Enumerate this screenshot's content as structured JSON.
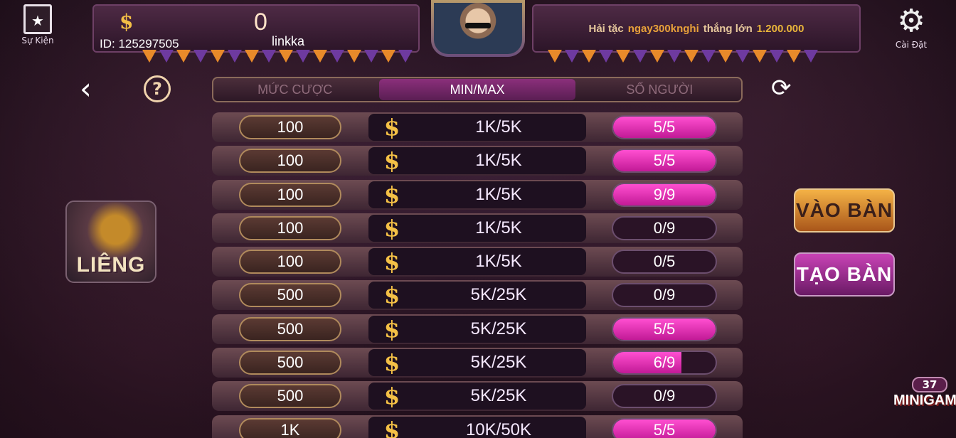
{
  "top": {
    "event_label": "Sự Kiện",
    "settings_label": "Cài Đặt",
    "balance": "0",
    "player_id": "ID: 125297505",
    "player_name": "linkka",
    "announcement": {
      "prefix": "Hải tặc",
      "user": "ngay300knghi",
      "mid": "thắng lớn",
      "amount": "1.200.000"
    }
  },
  "controls": {
    "back_icon": "chevron-left-icon",
    "help_label": "?",
    "refresh_icon": "refresh-icon"
  },
  "tabs": [
    {
      "label": "MỨC CƯỢC",
      "active": false
    },
    {
      "label": "MIN/MAX",
      "active": true
    },
    {
      "label": "SỐ NGƯỜI",
      "active": false
    }
  ],
  "game": {
    "name": "LIÊNG"
  },
  "rows": [
    {
      "bet": "100",
      "minmax": "1K/5K",
      "players": "5/5",
      "filled": 5,
      "capacity": 5
    },
    {
      "bet": "100",
      "minmax": "1K/5K",
      "players": "5/5",
      "filled": 5,
      "capacity": 5
    },
    {
      "bet": "100",
      "minmax": "1K/5K",
      "players": "9/9",
      "filled": 9,
      "capacity": 9
    },
    {
      "bet": "100",
      "minmax": "1K/5K",
      "players": "0/9",
      "filled": 0,
      "capacity": 9
    },
    {
      "bet": "100",
      "minmax": "1K/5K",
      "players": "0/5",
      "filled": 0,
      "capacity": 5
    },
    {
      "bet": "500",
      "minmax": "5K/25K",
      "players": "0/9",
      "filled": 0,
      "capacity": 9
    },
    {
      "bet": "500",
      "minmax": "5K/25K",
      "players": "5/5",
      "filled": 5,
      "capacity": 5
    },
    {
      "bet": "500",
      "minmax": "5K/25K",
      "players": "6/9",
      "filled": 6,
      "capacity": 9
    },
    {
      "bet": "500",
      "minmax": "5K/25K",
      "players": "0/9",
      "filled": 0,
      "capacity": 9
    },
    {
      "bet": "1K",
      "minmax": "10K/50K",
      "players": "5/5",
      "filled": 5,
      "capacity": 5
    }
  ],
  "actions": {
    "join_label": "VÀO BÀN",
    "create_label": "TẠO BÀN"
  },
  "minigame": {
    "count": "37",
    "label": "MINIGAME"
  },
  "colors": {
    "accent_gold": "#f4c046",
    "accent_pink": "#ff4fd1",
    "announce_user": "#e8a13a"
  }
}
